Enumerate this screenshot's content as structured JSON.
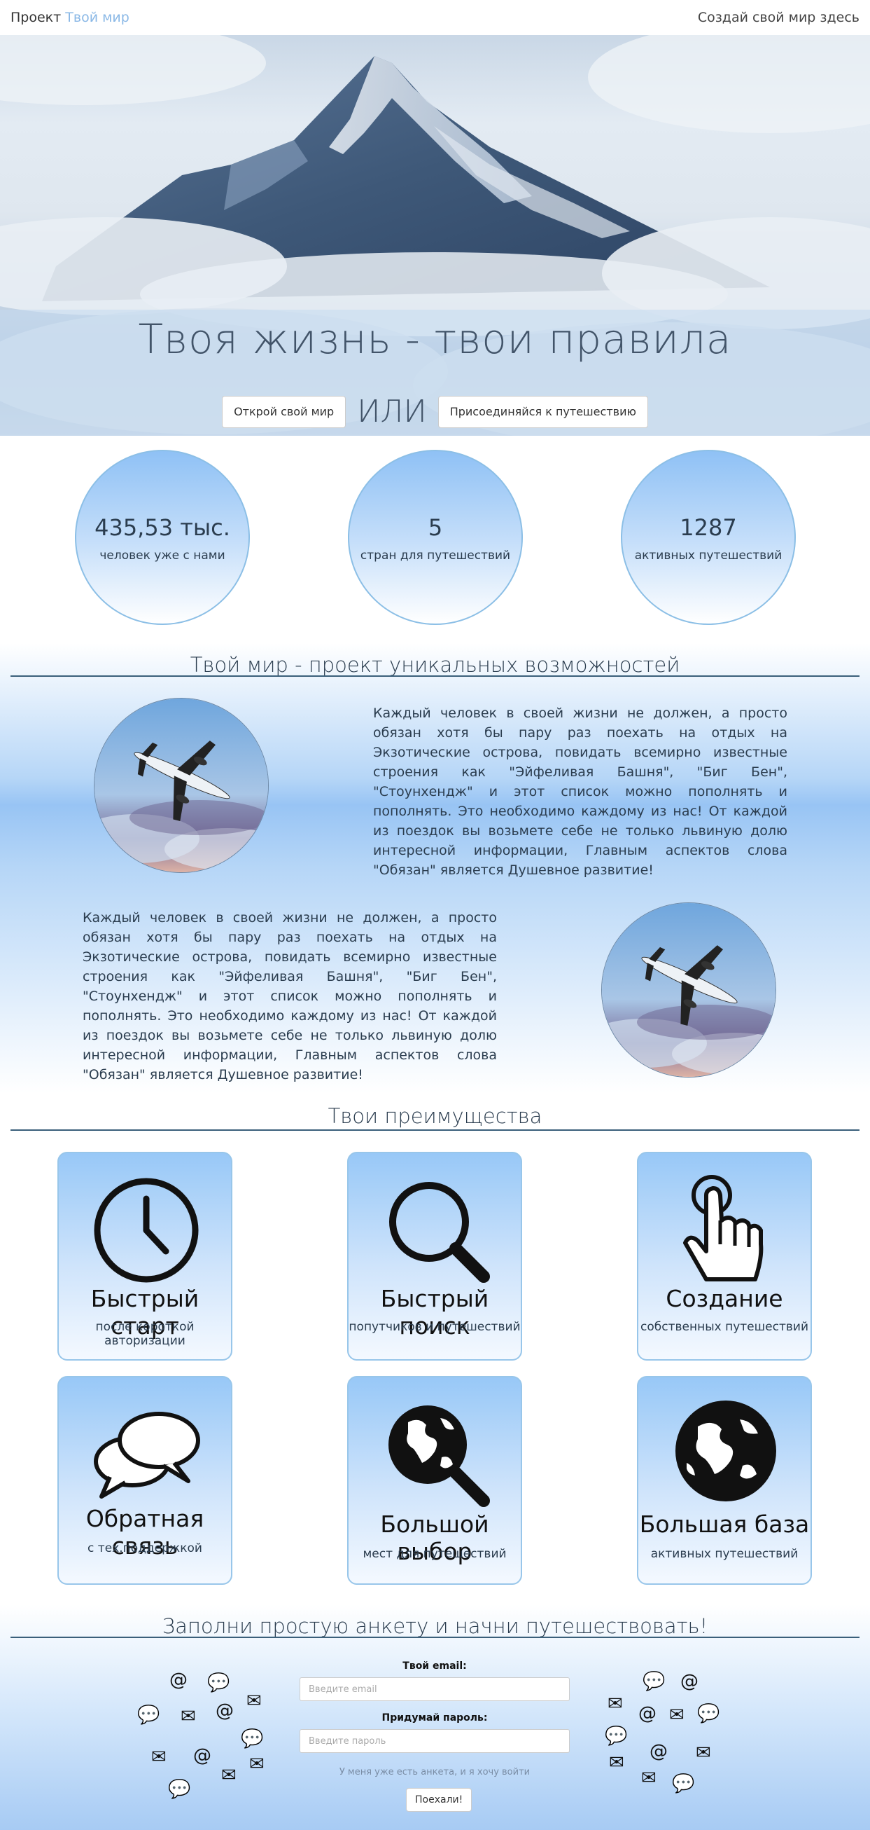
{
  "header": {
    "brand_prefix": "Проект",
    "brand_accent": "Твой мир",
    "create_link": "Создай свой мир здесь"
  },
  "hero": {
    "title": "Твоя жизнь - твои правила",
    "open_button": "Открой свой мир",
    "or_text": "ИЛИ",
    "join_button": "Присоединяйся к путешествию"
  },
  "stats": [
    {
      "value": "435,53 тыс.",
      "label": "человек уже с нами"
    },
    {
      "value": "5",
      "label": "стран для путешествий"
    },
    {
      "value": "1287",
      "label": "активных путешествий"
    }
  ],
  "unique": {
    "title": "Твой мир - проект уникальных возможностей",
    "paragraph_1": "Каждый человек в своей жизни не должен, а просто обязан хотя бы пару раз поехать на отдых на Экзотические острова, повидать всемирно известные строения как \"Эйфеливая Башня\", \"Биг Бен\", \"Стоунхендж\" и этот список можно пополнять и пополнять. Это необходимо каждому из нас! От каждой из поездок вы возьмете себе не только львиную долю интересной информации, Главным аспектов слова \"Обязан\" является Душевное развитие!",
    "paragraph_2": "Каждый человек в своей жизни не должен, а просто обязан хотя бы пару раз поехать на отдых на Экзотические острова, повидать всемирно известные строения как \"Эйфеливая Башня\", \"Биг Бен\", \"Стоунхендж\" и этот список можно пополнять и пополнять. Это необходимо каждому из нас! От каждой из поездок вы возьмете себе не только львиную долю интересной информации, Главным аспектов слова \"Обязан\" является Душевное развитие!"
  },
  "features": {
    "title": "Твои преимущества",
    "items": [
      {
        "title": "Быстрый старт",
        "subtitle": "после короткой авторизации",
        "icon": "clock-icon"
      },
      {
        "title": "Быстрый поиск",
        "subtitle": "попутчиков и путешествий",
        "icon": "magnifier-icon"
      },
      {
        "title": "Создание",
        "subtitle": "собственных путешествий",
        "icon": "pointing-hand-icon"
      },
      {
        "title": "Обратная связь",
        "subtitle": "с тех.поддержкой",
        "icon": "chat-bubbles-icon"
      },
      {
        "title": "Большой выбор",
        "subtitle": "мест для путешествий",
        "icon": "globe-search-icon"
      },
      {
        "title": "Большая база",
        "subtitle": "активных путешествий",
        "icon": "globe-icon"
      }
    ]
  },
  "signup": {
    "title": "Заполни простую анкету и начни путешествовать!",
    "email_label": "Твой email:",
    "email_placeholder": "Введите email",
    "password_label": "Придумай пароль:",
    "password_placeholder": "Введите пароль",
    "has_account": "У меня уже есть анкета, и я хочу войти",
    "submit": "Поехали!"
  },
  "colors": {
    "accent": "#8ab8e6",
    "circle_border": "#8cbfe6",
    "text": "#2b3d4f"
  }
}
